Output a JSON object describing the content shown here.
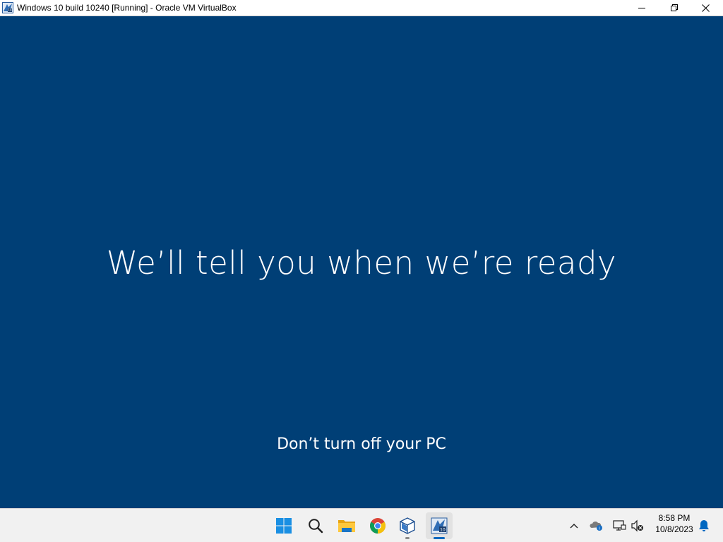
{
  "window": {
    "title": "Windows 10 build 10240 [Running] - Oracle VM VirtualBox",
    "app_icon": "virtualbox-vm-icon",
    "controls": [
      "minimize-icon",
      "restore-icon",
      "close-icon"
    ]
  },
  "guest_screen": {
    "background_color": "#003f76",
    "headline": "We’ll tell you when we’re ready",
    "subline": "Don’t turn off your PC"
  },
  "taskbar": {
    "pinned": [
      {
        "name": "start",
        "icon": "windows-start-icon"
      },
      {
        "name": "search",
        "icon": "search-icon"
      },
      {
        "name": "file-explorer",
        "icon": "folder-icon"
      },
      {
        "name": "chrome",
        "icon": "chrome-icon"
      },
      {
        "name": "virtualbox-manager",
        "icon": "virtualbox-icon",
        "running": true
      },
      {
        "name": "virtualbox-vm",
        "icon": "virtualbox-vm-icon",
        "running": true,
        "active": true
      }
    ],
    "tray": {
      "icons": [
        "chevron-up-icon",
        "onedrive-icon",
        "network-icon",
        "volume-muted-icon"
      ],
      "time": "8:58 PM",
      "date": "10/8/2023",
      "notification_icon": "bell-icon"
    }
  }
}
